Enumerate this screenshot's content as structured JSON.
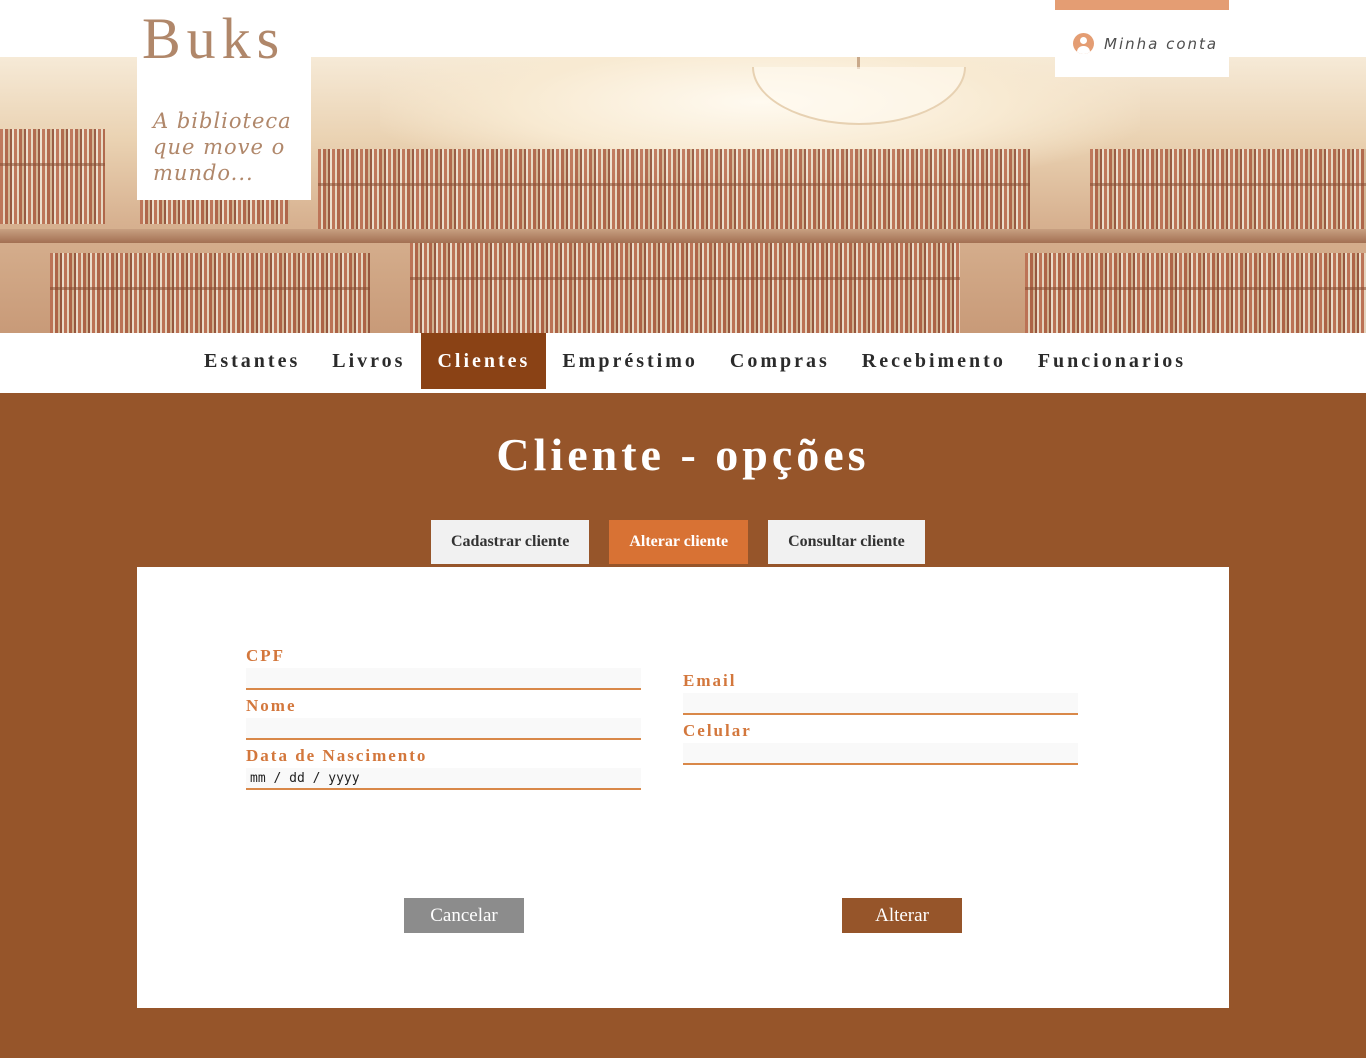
{
  "brand": {
    "name": "Buks",
    "tagline": "A biblioteca que move o mundo..."
  },
  "account": {
    "label": "Minha conta",
    "icon": "user-circle-icon"
  },
  "nav": {
    "items": [
      {
        "label": "Estantes"
      },
      {
        "label": "Livros"
      },
      {
        "label": "Clientes",
        "active": true
      },
      {
        "label": "Empréstimo"
      },
      {
        "label": "Compras"
      },
      {
        "label": "Recebimento"
      },
      {
        "label": "Funcionarios"
      }
    ]
  },
  "page": {
    "title": "Cliente - opções"
  },
  "tabs": [
    {
      "label": "Cadastrar cliente"
    },
    {
      "label": "Alterar cliente",
      "active": true
    },
    {
      "label": "Consultar cliente"
    }
  ],
  "form": {
    "cpf": {
      "label": "CPF",
      "value": ""
    },
    "nome": {
      "label": "Nome",
      "value": ""
    },
    "nascimento": {
      "label": "Data de Nascimento",
      "placeholder": "mm / dd / yyyy"
    },
    "email": {
      "label": "Email",
      "value": ""
    },
    "celular": {
      "label": "Celular",
      "value": ""
    }
  },
  "actions": {
    "cancel_label": "Cancelar",
    "submit_label": "Alterar"
  },
  "colors": {
    "background": "#96552a",
    "accent": "#d87234",
    "nav_active": "#8a4215",
    "logo": "#b0876a",
    "cancel": "#8c8c8c"
  }
}
